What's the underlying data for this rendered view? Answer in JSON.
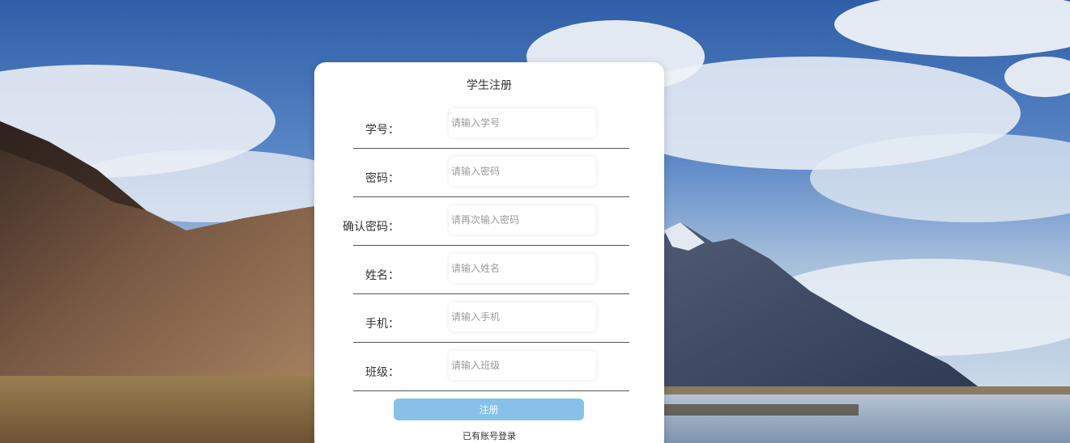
{
  "page": {
    "title": "学生注册"
  },
  "form": {
    "fields": [
      {
        "label": "学号：",
        "placeholder": "请输入学号",
        "value": ""
      },
      {
        "label": "密码：",
        "placeholder": "请输入密码",
        "value": ""
      },
      {
        "label": "确认密码：",
        "placeholder": "请再次输入密码",
        "value": ""
      },
      {
        "label": "姓名：",
        "placeholder": "请输入姓名",
        "value": ""
      },
      {
        "label": "手机：",
        "placeholder": "请输入手机",
        "value": ""
      },
      {
        "label": "班级：",
        "placeholder": "请输入班级",
        "value": ""
      }
    ],
    "submit_label": "注册",
    "login_link": "已有账号登录"
  },
  "colors": {
    "card_bg": "#ffffff",
    "button_bg": "#87c1ea",
    "sky": "#3f6fb5"
  }
}
